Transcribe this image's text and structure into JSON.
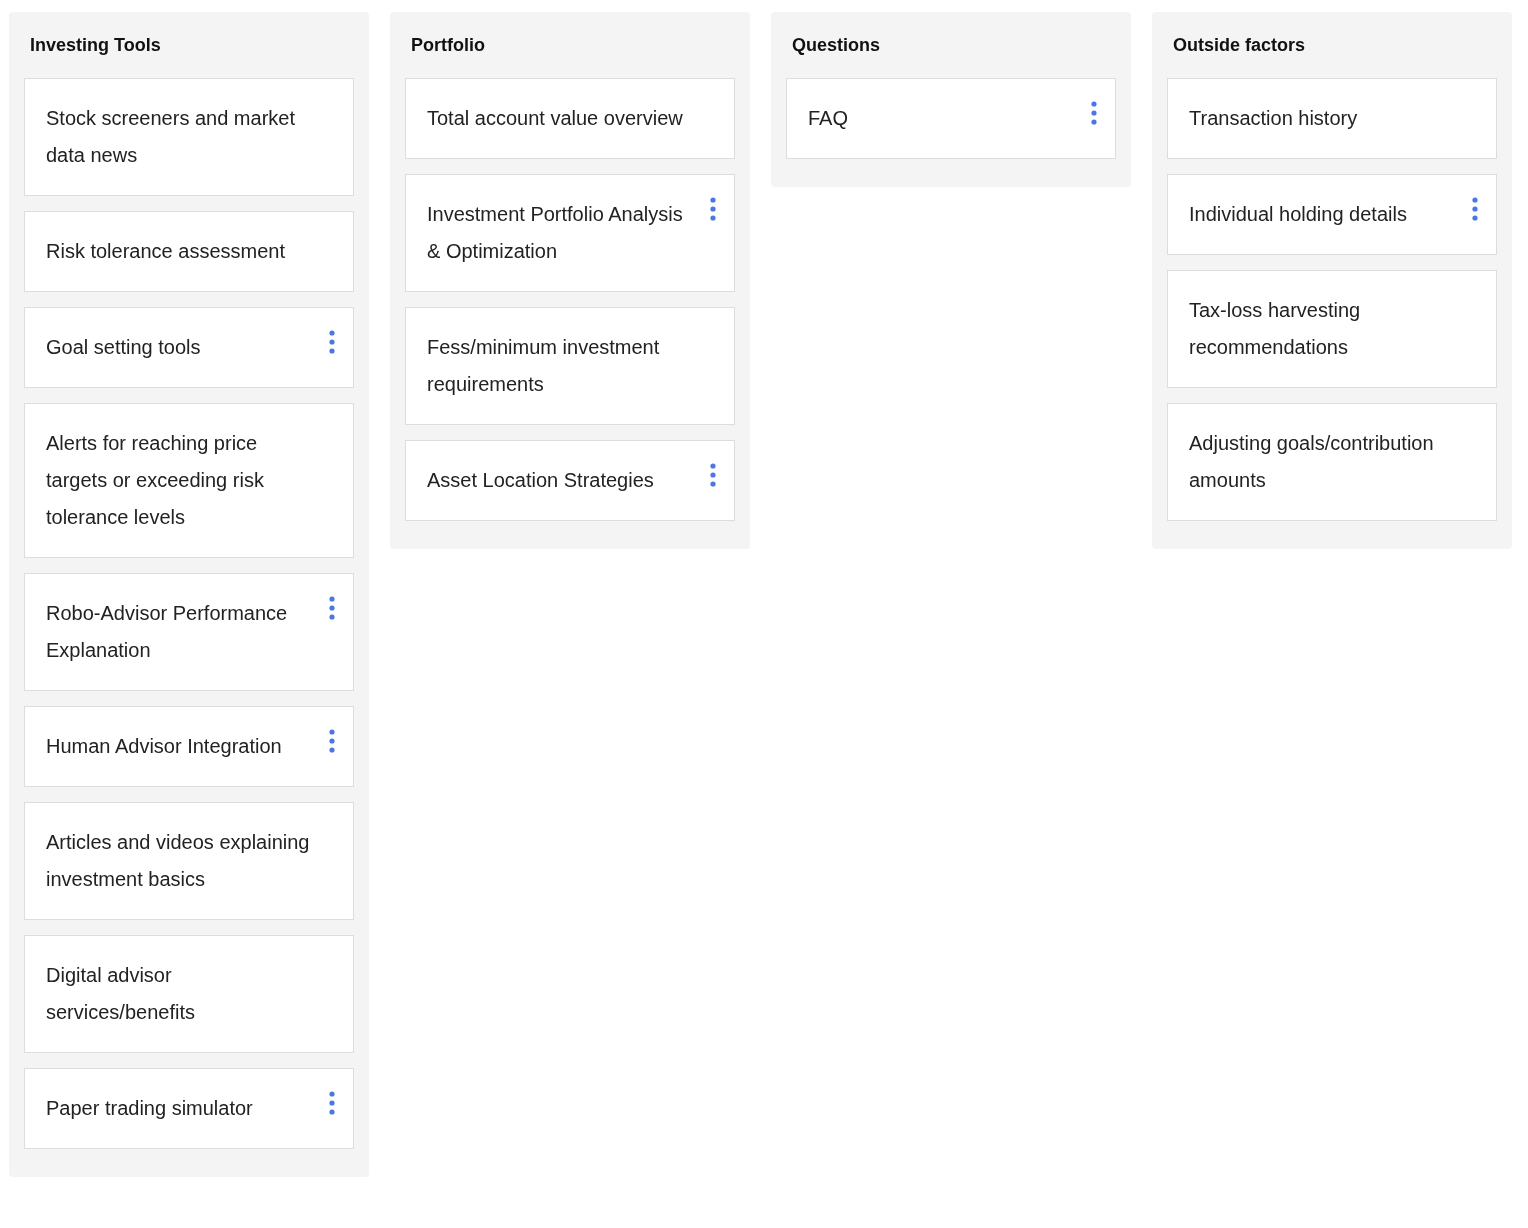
{
  "columns": [
    {
      "title": "Investing Tools",
      "cards": [
        {
          "text": "Stock screeners and market data news",
          "has_menu": false
        },
        {
          "text": "Risk tolerance assessment",
          "has_menu": false
        },
        {
          "text": "Goal setting tools",
          "has_menu": true
        },
        {
          "text": "Alerts for reaching price targets or exceeding risk tolerance levels",
          "has_menu": false
        },
        {
          "text": "Robo-Advisor Performance Explanation",
          "has_menu": true
        },
        {
          "text": "Human Advisor Integration",
          "has_menu": true
        },
        {
          "text": "Articles and videos explaining investment basics",
          "has_menu": false
        },
        {
          "text": "Digital advisor services/benefits",
          "has_menu": false
        },
        {
          "text": "Paper trading simulator",
          "has_menu": true
        }
      ]
    },
    {
      "title": "Portfolio",
      "cards": [
        {
          "text": "Total account value overview",
          "has_menu": false
        },
        {
          "text": "Investment Portfolio Analysis & Optimization",
          "has_menu": true
        },
        {
          "text": "Fess/minimum investment requirements",
          "has_menu": false
        },
        {
          "text": "Asset Location Strategies",
          "has_menu": true
        }
      ]
    },
    {
      "title": "Questions",
      "cards": [
        {
          "text": "FAQ",
          "has_menu": true
        }
      ]
    },
    {
      "title": "Outside factors",
      "cards": [
        {
          "text": "Transaction history",
          "has_menu": false
        },
        {
          "text": "Individual holding details",
          "has_menu": true
        },
        {
          "text": "Tax-loss harvesting recommendations",
          "has_menu": false
        },
        {
          "text": "Adjusting goals/contribution amounts",
          "has_menu": false
        }
      ]
    }
  ]
}
